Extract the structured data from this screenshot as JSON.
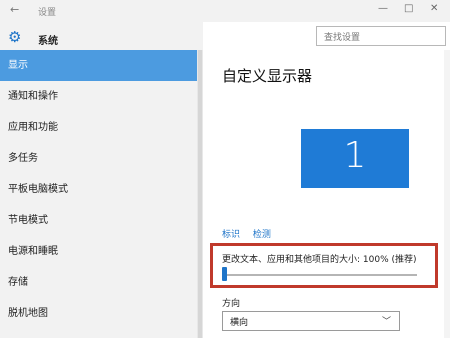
{
  "titlebar": {
    "title": "设置"
  },
  "app": {
    "name": "系统"
  },
  "search": {
    "placeholder": "查找设置"
  },
  "sidebar": {
    "items": [
      {
        "label": "显示",
        "active": true
      },
      {
        "label": "通知和操作"
      },
      {
        "label": "应用和功能"
      },
      {
        "label": "多任务"
      },
      {
        "label": "平板电脑模式"
      },
      {
        "label": "节电模式"
      },
      {
        "label": "电源和睡眠"
      },
      {
        "label": "存储"
      },
      {
        "label": "脱机地图"
      }
    ]
  },
  "main": {
    "title": "自定义显示器",
    "monitor_number": "1",
    "identify_label": "标识",
    "detect_label": "检测",
    "scale_label": "更改文本、应用和其他项目的大小: 100% (推荐)",
    "scale_value_percent": 100,
    "orientation_label": "方向",
    "orientation_value": "横向"
  },
  "colors": {
    "accent": "#1e74c8",
    "active_nav": "#4c9be0",
    "highlight_box": "#c0392b"
  },
  "icons": {
    "back": "back-arrow-icon",
    "settings": "gear-icon",
    "dropdown": "chevron-down-icon"
  }
}
